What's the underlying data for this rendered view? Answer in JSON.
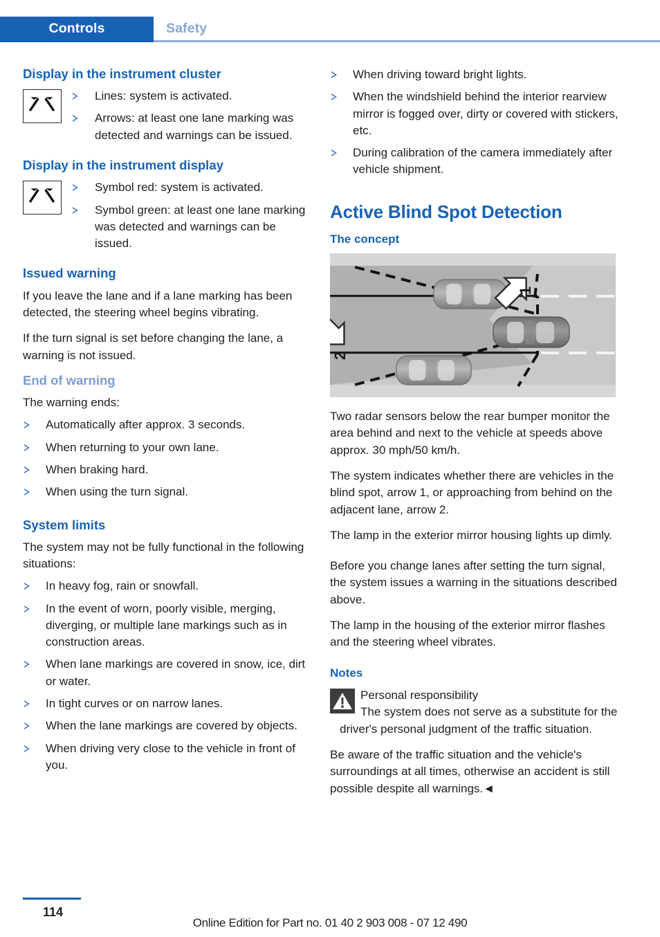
{
  "header": {
    "tab_active": "Controls",
    "tab_inactive": "Safety"
  },
  "colors": {
    "accent_blue": "#1862b4",
    "muted_blue": "#7e9cd4",
    "bullet_blue": "#4a7fc8",
    "warn_icon_bg": "#3d3d3d"
  },
  "left_column": {
    "section_cluster": {
      "heading": "Display in the instrument cluster",
      "icon": "lane-departure-symbol",
      "bullets": [
        "Lines: system is activated.",
        "Arrows: at least one lane marking was detected and warnings can be issued."
      ]
    },
    "section_display": {
      "heading": "Display in the instrument display",
      "icon": "lane-departure-symbol",
      "bullets": [
        "Symbol red: system is activated.",
        "Symbol green: at least one lane marking was detected and warnings can be issued."
      ]
    },
    "section_issued_warning": {
      "heading": "Issued warning",
      "paragraphs": [
        "If you leave the lane and if a lane marking has been detected, the steering wheel begins vibrating.",
        "If the turn signal is set before changing the lane, a warning is not issued."
      ]
    },
    "section_end_of_warning": {
      "heading": "End of warning",
      "intro": "The warning ends:",
      "bullets": [
        "Automatically after approx. 3 seconds.",
        "When returning to your own lane.",
        "When braking hard.",
        "When using the turn signal."
      ]
    },
    "section_system_limits": {
      "heading": "System limits",
      "intro": "The system may not be fully functional in the following situations:",
      "bullets": [
        "In heavy fog, rain or snowfall.",
        "In the event of worn, poorly visible, merging, diverging, or multiple lane markings such as in construction areas.",
        "When lane markings are covered in snow, ice, dirt or water.",
        "In tight curves or on narrow lanes.",
        "When the lane markings are covered by objects.",
        "When driving very close to the vehicle in front of you."
      ]
    }
  },
  "right_column": {
    "continued_bullets": [
      "When driving toward bright lights.",
      "When the windshield behind the interior rearview mirror is fogged over, dirty or covered with stickers, etc.",
      "During calibration of the camera immediately after vehicle shipment."
    ],
    "chapter_title": "Active Blind Spot Detection",
    "section_concept": {
      "heading": "The concept",
      "figure": {
        "name": "blind-spot-detection-illustration",
        "callout_1": "1",
        "callout_2": "2"
      },
      "paragraphs": [
        "Two radar sensors below the rear bumper monitor the area behind and next to the vehicle at speeds above approx. 30 mph/50 km/h.",
        "The system indicates whether there are vehicles in the blind spot, arrow 1, or approaching from behind on the adjacent lane, arrow 2.",
        "The lamp in the exterior mirror housing lights up dimly.",
        "Before you change lanes after setting the turn signal, the system issues a warning in the situations described above.",
        "The lamp in the housing of the exterior mirror flashes and the steering wheel vibrates."
      ]
    },
    "section_notes": {
      "heading": "Notes",
      "warning_title": "Personal responsibility",
      "warning_body": "The system does not serve as a substitute for the driver's personal judgment of the traffic situation.",
      "warning_body2": "Be aware of the traffic situation and the vehicle's surroundings at all times, otherwise an accident is still possible despite all warnings.◄"
    }
  },
  "footer": {
    "page_number": "114",
    "note": "Online Edition for Part no. 01 40 2 903 008 - 07 12 490"
  }
}
